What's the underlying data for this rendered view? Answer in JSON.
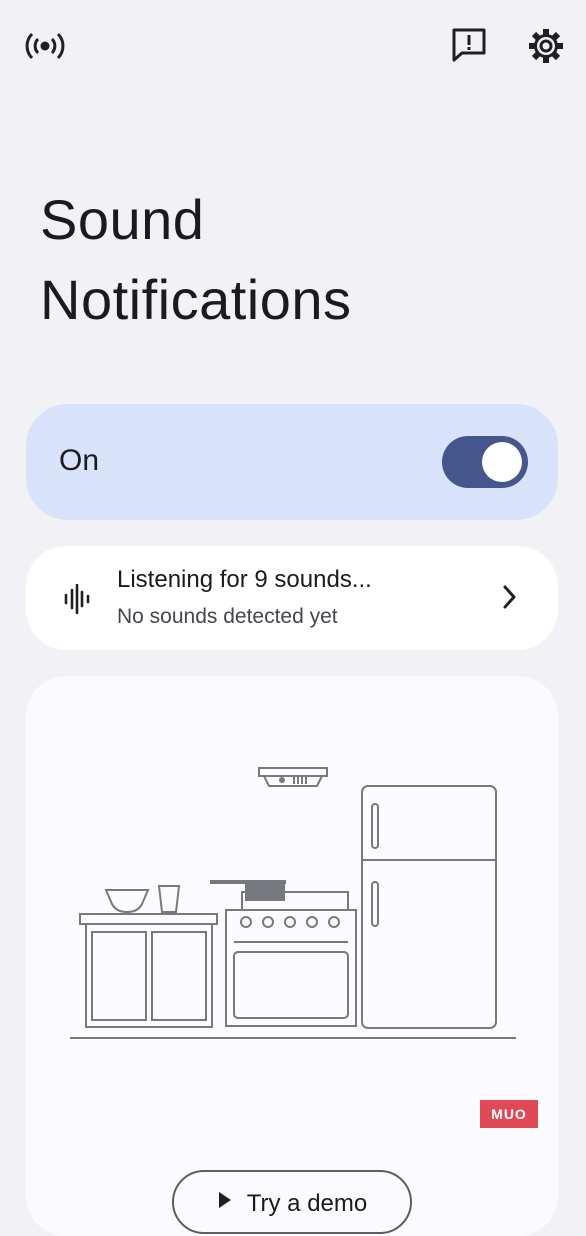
{
  "header": {
    "icons": [
      "live-caption-icon",
      "feedback-icon",
      "settings-icon"
    ]
  },
  "title": {
    "line1": "Sound",
    "line2": "Notifications"
  },
  "toggle": {
    "label": "On",
    "state": "on",
    "accent": "#44568b"
  },
  "listening": {
    "title": "Listening for 9 sounds...",
    "subtitle": "No sounds detected yet"
  },
  "illustration": {
    "watermark": "MUO"
  },
  "demo": {
    "label": "Try a demo"
  },
  "colors": {
    "background": "#f1f1f6",
    "toggle_card": "#d8e2fb",
    "card": "#ffffff"
  }
}
